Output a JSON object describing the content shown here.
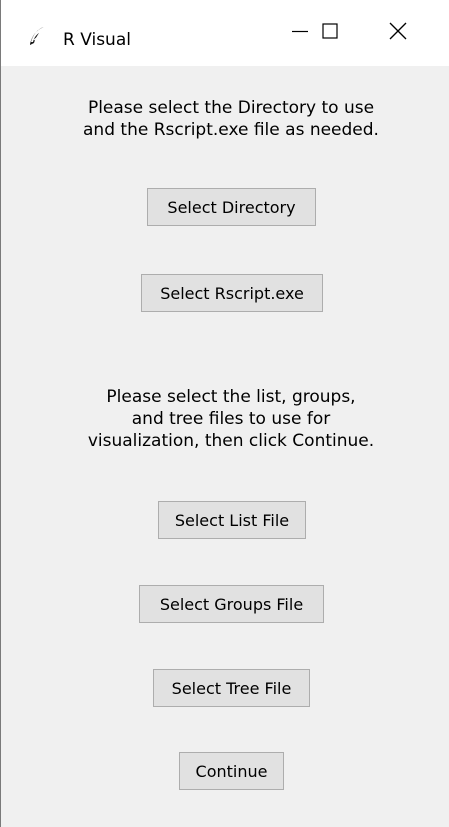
{
  "window": {
    "title": "R Visual",
    "icon": "feather-icon"
  },
  "titlebar_controls": {
    "minimize_icon": "minimize-icon",
    "maximize_icon": "maximize-icon",
    "close_icon": "close-icon"
  },
  "section1": {
    "instructions": "Please select the Directory to use\nand the Rscript.exe file as needed.",
    "select_directory_label": "Select Directory",
    "select_rscript_label": "Select Rscript.exe"
  },
  "section2": {
    "instructions": "Please select the list, groups,\nand tree files to use for\nvisualization, then click Continue.",
    "select_list_label": "Select List File",
    "select_groups_label": "Select Groups File",
    "select_tree_label": "Select Tree File",
    "continue_label": "Continue"
  }
}
